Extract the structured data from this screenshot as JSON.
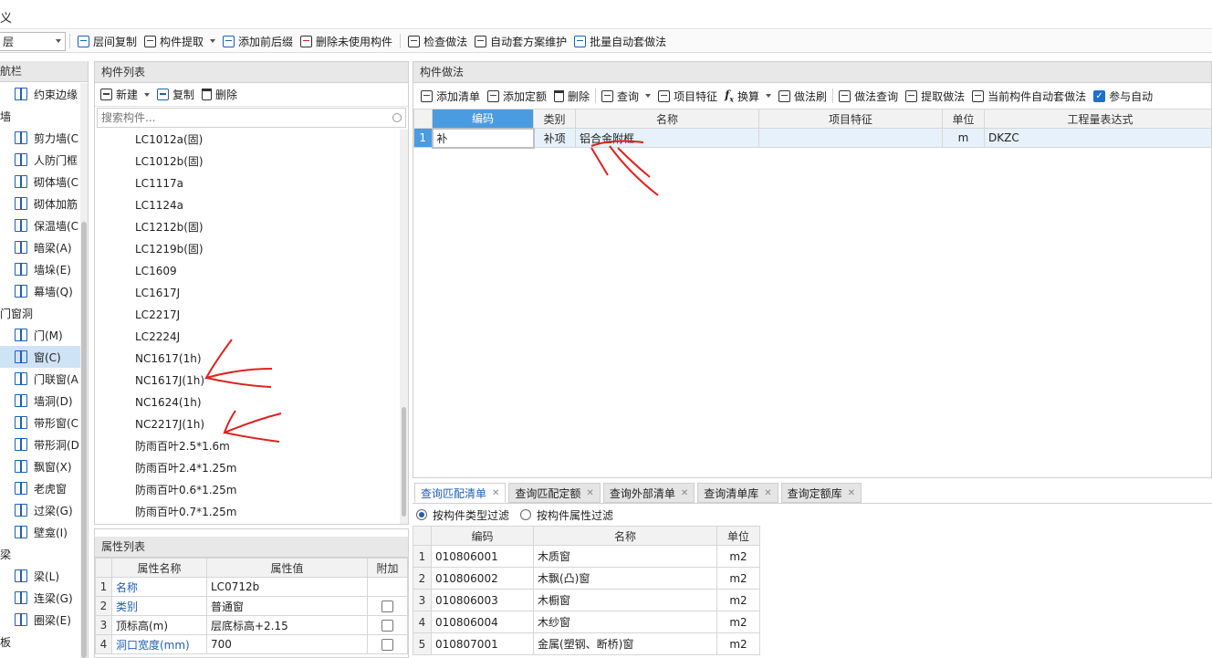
{
  "menu": {
    "partial_label": "义"
  },
  "toolbar": {
    "floor_select": "层",
    "buttons": [
      {
        "label": "层间复制",
        "icon": "copy-icon"
      },
      {
        "label": "构件提取",
        "icon": "extract-icon",
        "dropdown": true
      },
      {
        "label": "添加前后缀",
        "icon": "prefix-icon"
      },
      {
        "label": "删除未使用构件",
        "icon": "delete-unused-icon"
      },
      {
        "label": "检查做法",
        "icon": "check-icon"
      },
      {
        "label": "自动套方案维护",
        "icon": "auto-scheme-icon"
      },
      {
        "label": "批量自动套做法",
        "icon": "batch-auto-icon"
      }
    ]
  },
  "nav": {
    "title": "航栏",
    "items": [
      {
        "type": "item",
        "label": "约束边缘"
      },
      {
        "type": "group",
        "label": "墙"
      },
      {
        "type": "item",
        "label": "剪力墙(C"
      },
      {
        "type": "item",
        "label": "人防门框"
      },
      {
        "type": "item",
        "label": "砌体墙(C"
      },
      {
        "type": "item",
        "label": "砌体加筋"
      },
      {
        "type": "item",
        "label": "保温墙(C"
      },
      {
        "type": "item",
        "label": "暗梁(A)"
      },
      {
        "type": "item",
        "label": "墙垛(E)"
      },
      {
        "type": "item",
        "label": "幕墙(Q)"
      },
      {
        "type": "group",
        "label": "门窗洞"
      },
      {
        "type": "item",
        "label": "门(M)"
      },
      {
        "type": "item",
        "label": "窗(C)",
        "selected": true
      },
      {
        "type": "item",
        "label": "门联窗(A"
      },
      {
        "type": "item",
        "label": "墙洞(D)"
      },
      {
        "type": "item",
        "label": "带形窗(C"
      },
      {
        "type": "item",
        "label": "带形洞(D"
      },
      {
        "type": "item",
        "label": "飘窗(X)"
      },
      {
        "type": "item",
        "label": "老虎窗"
      },
      {
        "type": "item",
        "label": "过梁(G)"
      },
      {
        "type": "item",
        "label": "壁龛(I)"
      },
      {
        "type": "group",
        "label": "梁"
      },
      {
        "type": "item",
        "label": "梁(L)"
      },
      {
        "type": "item",
        "label": "连梁(G)"
      },
      {
        "type": "item",
        "label": "圈梁(E)"
      },
      {
        "type": "group",
        "label": "板"
      }
    ]
  },
  "component_list": {
    "title": "构件列表",
    "new_label": "新建",
    "copy_label": "复制",
    "delete_label": "删除",
    "search_placeholder": "搜索构件...",
    "items": [
      "LC1012a(固)",
      "LC1012b(固)",
      "LC1117a",
      "LC1124a",
      "LC1212b(固)",
      "LC1219b(固)",
      "LC1609",
      "LC1617J",
      "LC2217J",
      "LC2224J",
      "NC1617(1h)",
      "NC1617J(1h)",
      "NC1624(1h)",
      "NC2217J(1h)",
      "防雨百叶2.5*1.6m",
      "防雨百叶2.4*1.25m",
      "防雨百叶0.6*1.25m",
      "防雨百叶0.7*1.25m"
    ]
  },
  "properties": {
    "title": "属性列表",
    "headers": [
      "属性名称",
      "属性值",
      "附加"
    ],
    "rows": [
      {
        "n": "1",
        "name": "名称",
        "value": "LC0712b",
        "blue": true,
        "checkbox": false
      },
      {
        "n": "2",
        "name": "类别",
        "value": "普通窗",
        "blue": true,
        "checkbox": true
      },
      {
        "n": "3",
        "name": "顶标高(m)",
        "value": "层底标高+2.15",
        "blue": false,
        "checkbox": true
      },
      {
        "n": "4",
        "name": "洞口宽度(mm)",
        "value": "700",
        "blue": true,
        "checkbox": true
      }
    ]
  },
  "method": {
    "title": "构件做法",
    "toolbar": [
      {
        "label": "添加清单",
        "icon": "add-list-icon"
      },
      {
        "label": "添加定额",
        "icon": "add-quota-icon"
      },
      {
        "label": "删除",
        "icon": "delete-icon"
      },
      {
        "label": "查询",
        "icon": "query-icon",
        "dropdown": true
      },
      {
        "label": "项目特征",
        "icon": "feature-icon"
      },
      {
        "label": "换算",
        "icon": "fx-icon",
        "dropdown": true
      },
      {
        "label": "做法刷",
        "icon": "brush-icon"
      },
      {
        "label": "做法查询",
        "icon": "method-query-icon"
      },
      {
        "label": "提取做法",
        "icon": "extract-method-icon"
      },
      {
        "label": "当前构件自动套做法",
        "icon": "auto-apply-icon"
      }
    ],
    "participate_label": "参与自动",
    "headers": [
      "编码",
      "类别",
      "名称",
      "项目特征",
      "单位",
      "工程量表达式"
    ],
    "rows": [
      {
        "n": "1",
        "code": "补",
        "category": "补项",
        "name": "铝合金附框",
        "feature": "",
        "unit": "m",
        "expr": "DKZC"
      }
    ]
  },
  "bottom_tabs": [
    "查询匹配清单",
    "查询匹配定额",
    "查询外部清单",
    "查询清单库",
    "查询定额库"
  ],
  "filters": {
    "type_filter": "按构件类型过滤",
    "attr_filter": "按构件属性过滤"
  },
  "match_table": {
    "headers": [
      "编码",
      "名称",
      "单位"
    ],
    "rows": [
      {
        "n": "1",
        "code": "010806001",
        "name": "木质窗",
        "unit": "m2"
      },
      {
        "n": "2",
        "code": "010806002",
        "name": "木飘(凸)窗",
        "unit": "m2"
      },
      {
        "n": "3",
        "code": "010806003",
        "name": "木橱窗",
        "unit": "m2"
      },
      {
        "n": "4",
        "code": "010806004",
        "name": "木纱窗",
        "unit": "m2"
      },
      {
        "n": "5",
        "code": "010807001",
        "name": "金属(塑钢、断桥)窗",
        "unit": "m2"
      }
    ]
  },
  "annotation_color": "#e02020"
}
